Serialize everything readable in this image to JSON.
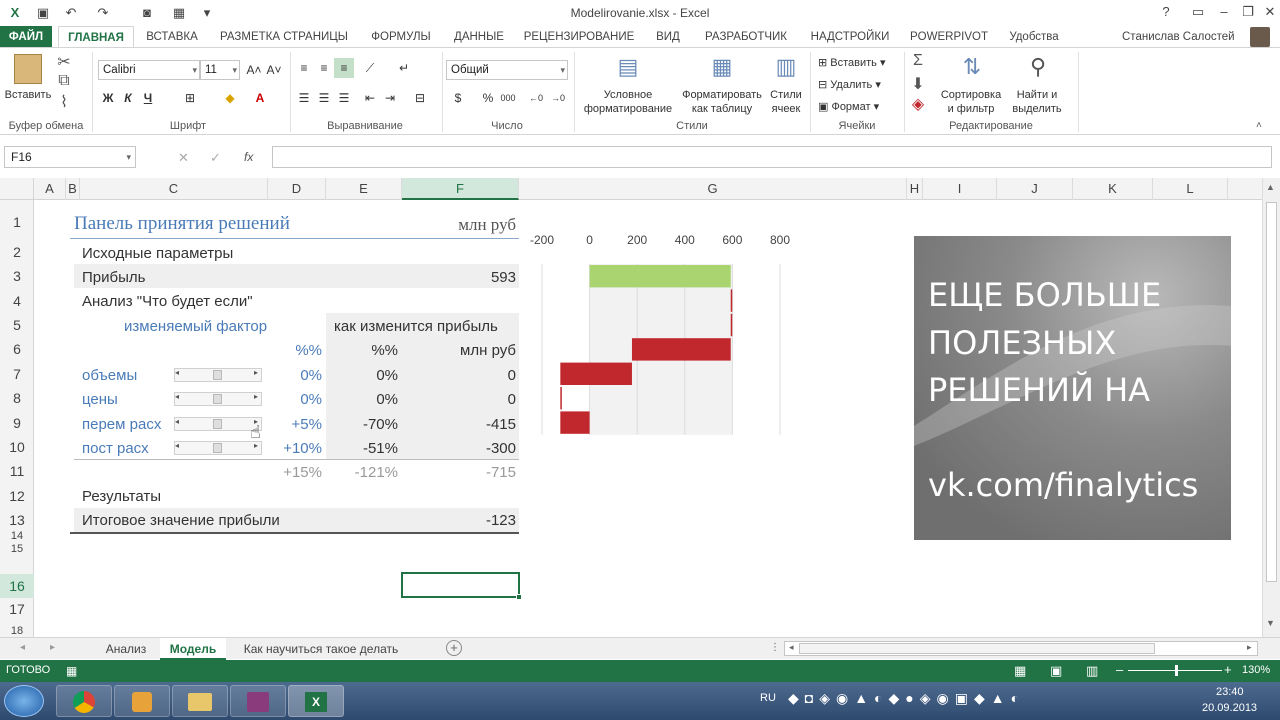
{
  "window": {
    "title": "Modelirovanie.xlsx - Excel"
  },
  "tabs": [
    {
      "label": "ФАЙЛ"
    },
    {
      "label": "ГЛАВНАЯ"
    },
    {
      "label": "ВСТАВКА"
    },
    {
      "label": "РАЗМЕТКА СТРАНИЦЫ"
    },
    {
      "label": "ФОРМУЛЫ"
    },
    {
      "label": "ДАННЫЕ"
    },
    {
      "label": "РЕЦЕНЗИРОВАНИЕ"
    },
    {
      "label": "ВИД"
    },
    {
      "label": "РАЗРАБОТЧИК"
    },
    {
      "label": "НАДСТРОЙКИ"
    },
    {
      "label": "POWERPIVOT"
    },
    {
      "label": "Удобства"
    }
  ],
  "user": "Станислав Салостей",
  "ribbon": {
    "paste": "Вставить",
    "font_name": "Calibri",
    "font_size": "11",
    "number_format": "Общий",
    "bold": "Ж",
    "italic": "К",
    "underline": "Ч",
    "cond_format": [
      "Условное",
      "форматирование"
    ],
    "format_table": [
      "Форматировать",
      "как таблицу"
    ],
    "cell_styles": [
      "Стили",
      "ячеек"
    ],
    "insert": "Вставить",
    "delete": "Удалить",
    "format": "Формат",
    "sort": [
      "Сортировка",
      "и фильтр"
    ],
    "find": [
      "Найти и",
      "выделить"
    ],
    "groups": {
      "clipboard": "Буфер обмена",
      "font": "Шрифт",
      "align": "Выравнивание",
      "number": "Число",
      "styles": "Стили",
      "cells": "Ячейки",
      "editing": "Редактирование"
    }
  },
  "namebox": "F16",
  "fx": "fx",
  "columns": [
    "A",
    "B",
    "C",
    "D",
    "E",
    "F",
    "G",
    "H",
    "I",
    "J",
    "K",
    "L"
  ],
  "rows": [
    "1",
    "2",
    "3",
    "4",
    "5",
    "6",
    "7",
    "8",
    "9",
    "10",
    "11",
    "12",
    "13",
    "14",
    "15",
    "16",
    "17",
    "18"
  ],
  "sheet": {
    "title": "Панель принятия решений",
    "unit": "млн руб",
    "params": "Исходные параметры",
    "profit_label": "Прибыль",
    "profit_value": "593",
    "whatif": "Анализ \"Что будет если\"",
    "factor_hdr": "изменяемый фактор",
    "change_hdr": "как изменится прибыль",
    "pct1": "%%",
    "pct2": "%%",
    "mln": "млн руб",
    "factors": [
      {
        "name": "объемы",
        "pct": "0%",
        "chg": "0%",
        "mln": "0",
        "slider": 0.5
      },
      {
        "name": "цены",
        "pct": "0%",
        "chg": "0%",
        "mln": "0",
        "slider": 0.5
      },
      {
        "name": "перем расх",
        "pct": "+5%",
        "chg": "-70%",
        "mln": "-415",
        "slider": 0.5
      },
      {
        "name": "пост расх",
        "pct": "+10%",
        "chg": "-51%",
        "mln": "-300",
        "slider": 0.5
      }
    ],
    "total_row": {
      "pct": "+15%",
      "chg": "-121%",
      "mln": "-715"
    },
    "results": "Результаты",
    "final_label": "Итоговое значение прибыли",
    "final_value": "-123"
  },
  "chart_data": {
    "type": "bar",
    "orientation": "horizontal-waterfall",
    "xticks": [
      "-200",
      "0",
      "200",
      "400",
      "600",
      "800"
    ],
    "xlim": [
      -200,
      800
    ],
    "bars": [
      {
        "start": 0,
        "end": 593,
        "color": "#a9d46f"
      },
      {
        "start": 593,
        "end": 593,
        "color": "#c0282d"
      },
      {
        "start": 593,
        "end": 593,
        "color": "#c0282d"
      },
      {
        "start": 178,
        "end": 593,
        "color": "#c0282d"
      },
      {
        "start": -123,
        "end": 178,
        "color": "#c0282d"
      },
      {
        "start": -123,
        "end": -123,
        "color": "#c0282d"
      },
      {
        "start": -123,
        "end": 0,
        "color": "#c0282d"
      }
    ]
  },
  "promo": {
    "lines": [
      "ЕЩЕ БОЛЬШЕ",
      "ПОЛЕЗНЫХ",
      "РЕШЕНИЙ НА"
    ],
    "link": "vk.com/finalytics"
  },
  "sheet_tabs": [
    "Анализ",
    "Модель",
    "Как научиться такое делать"
  ],
  "status": {
    "ready": "ГОТОВО",
    "zoom": "130%"
  },
  "taskbar": {
    "lang": "RU",
    "time": "23:40",
    "date": "20.09.2013"
  }
}
